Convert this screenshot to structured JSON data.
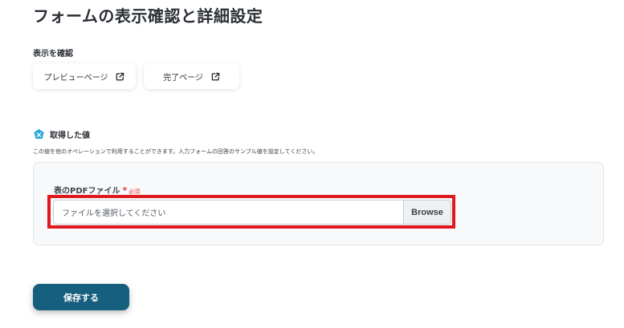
{
  "page": {
    "title": "フォームの表示確認と詳細設定"
  },
  "preview_section": {
    "label": "表示を確認",
    "buttons": [
      {
        "label": "プレビューページ",
        "icon": "external-link-icon"
      },
      {
        "label": "完了ページ",
        "icon": "external-link-icon"
      }
    ]
  },
  "acquired_values": {
    "icon": "acquired-value-icon",
    "label": "取得した値",
    "description": "この値を他のオペレーションで利用することができます。入力フォームの回答のサンプル値を設定してください。"
  },
  "form_field": {
    "label": "表のPDFファイル",
    "required_mark": "*",
    "required_text": "必須",
    "placeholder": "ファイルを選択してください",
    "browse_label": "Browse"
  },
  "actions": {
    "save_label": "保存する"
  },
  "colors": {
    "primary": "#165f7f",
    "required": "#e53935",
    "highlight": "#e0191e",
    "acquired_icon": "#2aa9d8"
  }
}
